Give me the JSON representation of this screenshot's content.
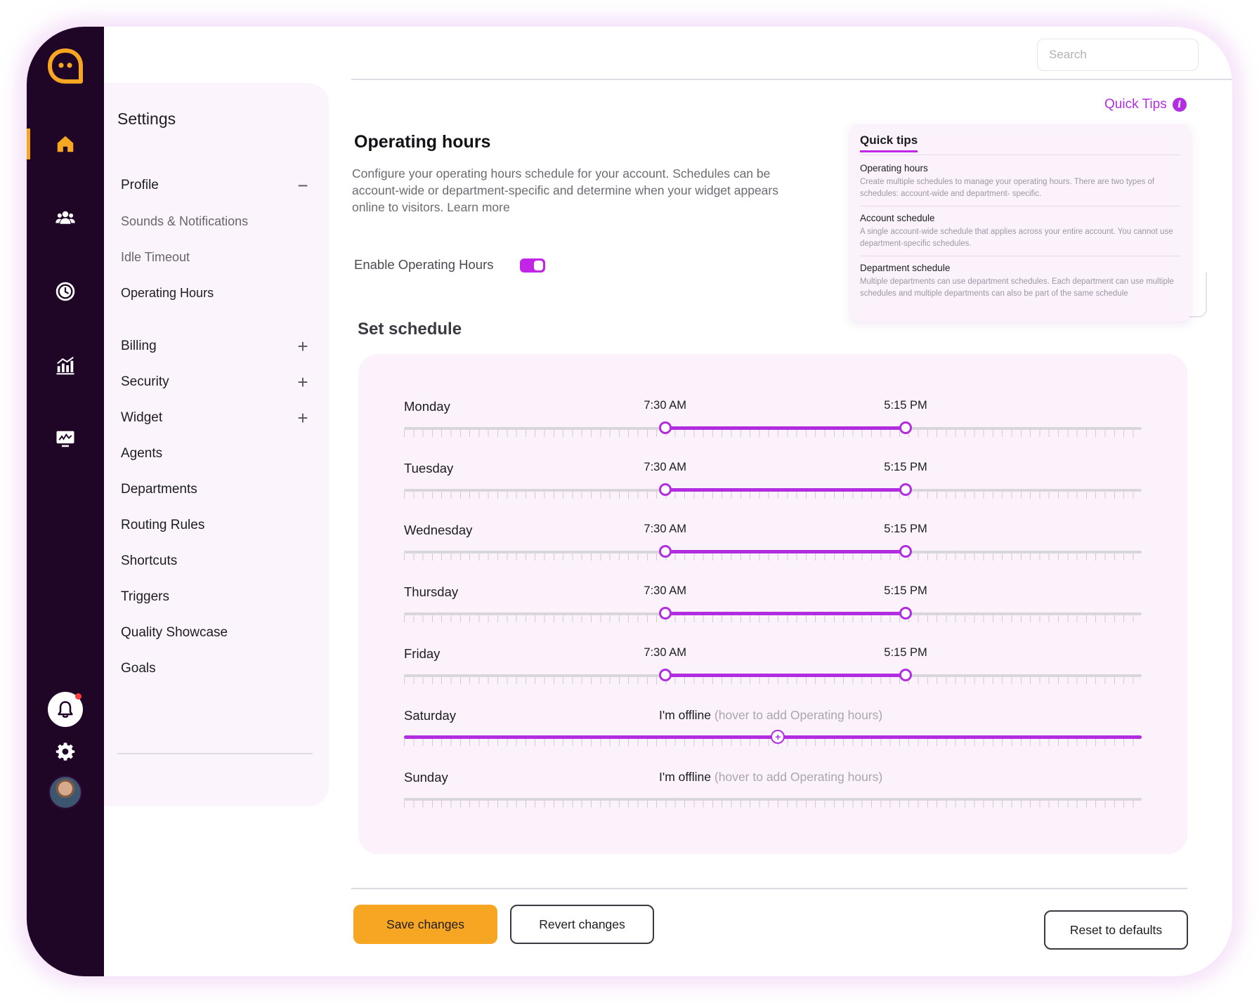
{
  "colors": {
    "rail_bg": "#1f0627",
    "accent_purple": "#b02ee0",
    "accent_orange": "#f7a623",
    "panel_bg": "#fcf4fc"
  },
  "rail": {
    "logo": "chat-bubble-logo-icon",
    "items": [
      {
        "icon": "home-icon",
        "active": true
      },
      {
        "icon": "team-icon",
        "active": false
      },
      {
        "icon": "clock-icon",
        "active": false
      },
      {
        "icon": "analytics-icon",
        "active": false
      },
      {
        "icon": "monitor-icon",
        "active": false
      }
    ],
    "bottom": [
      "bell-icon",
      "gear-icon",
      "avatar"
    ]
  },
  "search": {
    "placeholder": "Search",
    "value": ""
  },
  "settings": {
    "title": "Settings",
    "items": [
      {
        "label": "Profile",
        "toggle": "−"
      },
      {
        "label": "Sounds & Notifications"
      },
      {
        "label": "Idle Timeout"
      },
      {
        "label": "Operating Hours"
      },
      {
        "label": "Billing",
        "toggle": "+"
      },
      {
        "label": "Security",
        "toggle": "+"
      },
      {
        "label": "Widget",
        "toggle": "+"
      },
      {
        "label": "Agents"
      },
      {
        "label": "Departments"
      },
      {
        "label": "Routing Rules"
      },
      {
        "label": "Shortcuts"
      },
      {
        "label": "Triggers"
      },
      {
        "label": "Quality Showcase"
      },
      {
        "label": "Goals"
      }
    ]
  },
  "quick_tips_link": "Quick Tips",
  "quick_tips": {
    "title": "Quick tips",
    "tips": [
      {
        "title": "Operating hours",
        "body": "Create multiple schedules to manage your operating hours. There are two types of schedules: account-wide and department- specific."
      },
      {
        "title": "Account schedule",
        "body": "A single account-wide schedule that applies across your entire account. You cannot use department-specific schedules."
      },
      {
        "title": "Department schedule",
        "body": "Multiple departments can use department schedules. Each department can use multiple schedules and multiple departments can also be part of the same schedule"
      }
    ]
  },
  "main": {
    "title": "Operating hours",
    "description": "Configure your operating hours schedule for your account. Schedules can be account-wide or department-specific and determine when your widget appears online to visitors. Learn more",
    "enable_label": "Enable Operating Hours",
    "enabled": true,
    "schedule_title": "Set schedule"
  },
  "schedule": {
    "days": [
      {
        "day": "Monday",
        "start": "7:30 AM",
        "end": "5:15 PM",
        "start_frac": 0.354,
        "end_frac": 0.68
      },
      {
        "day": "Tuesday",
        "start": "7:30 AM",
        "end": "5:15 PM",
        "start_frac": 0.354,
        "end_frac": 0.68
      },
      {
        "day": "Wednesday",
        "start": "7:30 AM",
        "end": "5:15 PM",
        "start_frac": 0.354,
        "end_frac": 0.68
      },
      {
        "day": "Thursday",
        "start": "7:30 AM",
        "end": "5:15 PM",
        "start_frac": 0.354,
        "end_frac": 0.68
      },
      {
        "day": "Friday",
        "start": "7:30 AM",
        "end": "5:15 PM",
        "start_frac": 0.354,
        "end_frac": 0.68
      },
      {
        "day": "Saturday",
        "offline": "I'm offline",
        "hint": "(hover to add Operating hours)",
        "hover": true
      },
      {
        "day": "Sunday",
        "offline": "I'm offline",
        "hint": "(hover to add Operating hours)",
        "hover": false
      }
    ]
  },
  "footer": {
    "save": "Save changes",
    "revert": "Revert changes",
    "reset": "Reset to defaults"
  }
}
